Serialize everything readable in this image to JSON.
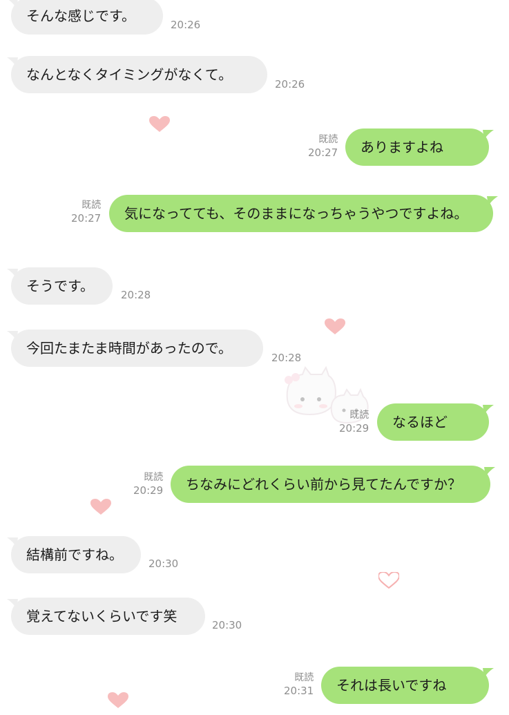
{
  "messages": [
    {
      "side": "in",
      "text": "そんな感じです。",
      "time": "20:26"
    },
    {
      "side": "in",
      "text": "なんとなくタイミングがなくて。",
      "time": "20:26"
    },
    {
      "side": "out",
      "text": "ありますよね",
      "time": "20:27",
      "read": "既読"
    },
    {
      "side": "out",
      "text": "気になってても、そのままになっちゃうやつですよね。",
      "time": "20:27",
      "read": "既読"
    },
    {
      "side": "in",
      "text": "そうです。",
      "time": "20:28"
    },
    {
      "side": "in",
      "text": "今回たまたま時間があったので。",
      "time": "20:28"
    },
    {
      "side": "out",
      "text": "なるほど",
      "time": "20:29",
      "read": "既読"
    },
    {
      "side": "out",
      "text": "ちなみにどれくらい前から見てたんですか？",
      "time": "20:29",
      "read": "既読"
    },
    {
      "side": "in",
      "text": "結構前ですね。",
      "time": "20:30"
    },
    {
      "side": "in",
      "text": "覚えてないくらいです笑",
      "time": "20:30"
    },
    {
      "side": "out",
      "text": "それは長いですね",
      "time": "20:31",
      "read": "既読"
    }
  ],
  "colors": {
    "incoming_bubble": "#eeeeee",
    "outgoing_bubble": "#a6e27a",
    "meta_text": "#8e8e8e",
    "heart": "#f4a3a3"
  },
  "decor": {
    "heart_icon": "heart-icon",
    "sticker_icon": "cat-sticker-icon"
  }
}
